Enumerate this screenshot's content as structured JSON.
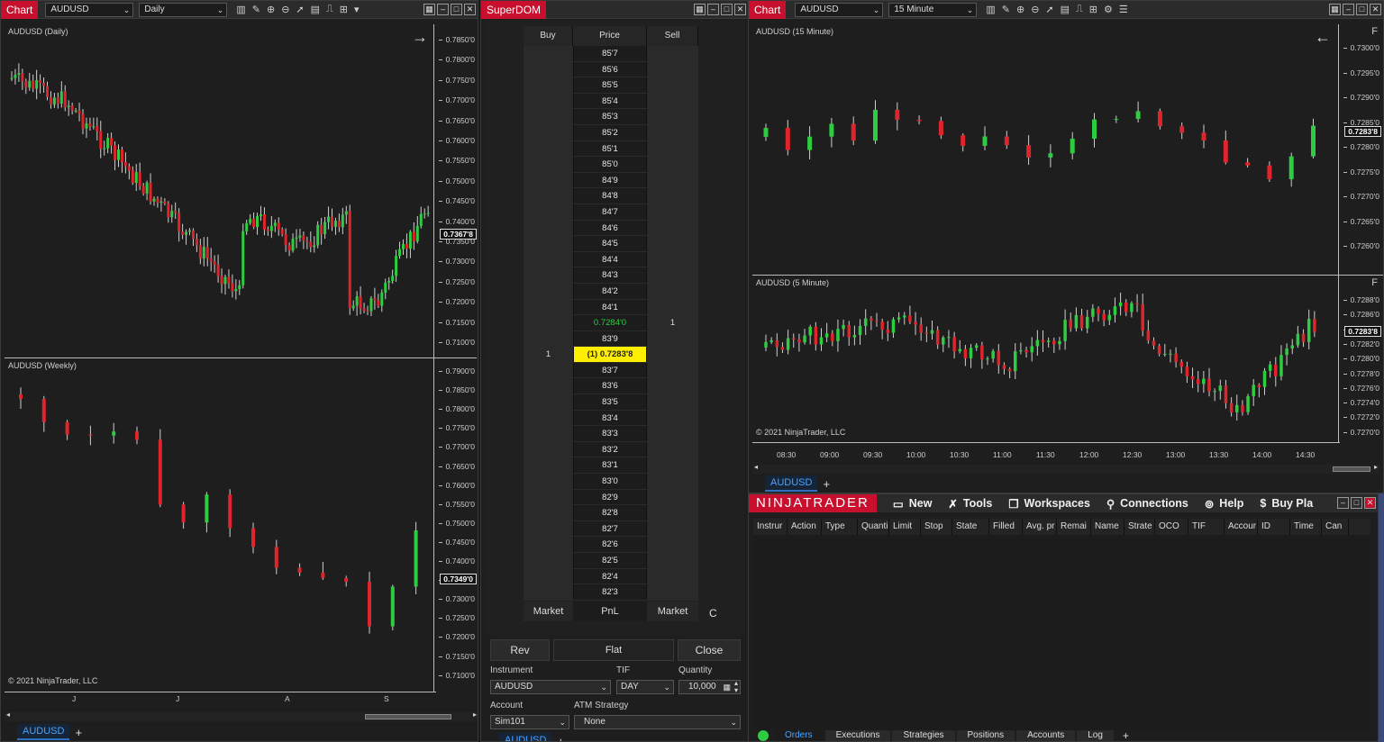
{
  "chart_left": {
    "title_label": "Chart",
    "instrument": "AUDUSD",
    "interval": "Daily",
    "panel_daily": {
      "title": "AUDUSD (Daily)",
      "y_labels": [
        "0.7850'0",
        "0.7800'0",
        "0.7750'0",
        "0.7700'0",
        "0.7650'0",
        "0.7600'0",
        "0.7550'0",
        "0.7500'0",
        "0.7450'0",
        "0.7400'0",
        "0.7350'0",
        "0.7300'0",
        "0.7250'0",
        "0.7200'0",
        "0.7150'0",
        "0.7100'0"
      ],
      "last_price": "0.7367'8"
    },
    "panel_weekly": {
      "title": "AUDUSD (Weekly)",
      "y_labels": [
        "0.7900'0",
        "0.7850'0",
        "0.7800'0",
        "0.7750'0",
        "0.7700'0",
        "0.7650'0",
        "0.7600'0",
        "0.7550'0",
        "0.7500'0",
        "0.7450'0",
        "0.7400'0",
        "0.7350'0",
        "0.7300'0",
        "0.7250'0",
        "0.7200'0",
        "0.7150'0",
        "0.7100'0"
      ],
      "last_price": "0.7349'0",
      "copyright": "© 2021 NinjaTrader, LLC",
      "x_labels": [
        "J",
        "J",
        "A",
        "S"
      ]
    },
    "tab": "AUDUSD"
  },
  "superdom": {
    "title": "SuperDOM",
    "headers": {
      "buy": "Buy",
      "price": "Price",
      "sell": "Sell"
    },
    "rows": [
      {
        "buy": "",
        "price": "85'7",
        "sell": ""
      },
      {
        "buy": "",
        "price": "85'6",
        "sell": ""
      },
      {
        "buy": "",
        "price": "85'5",
        "sell": ""
      },
      {
        "buy": "",
        "price": "85'4",
        "sell": ""
      },
      {
        "buy": "",
        "price": "85'3",
        "sell": ""
      },
      {
        "buy": "",
        "price": "85'2",
        "sell": ""
      },
      {
        "buy": "",
        "price": "85'1",
        "sell": ""
      },
      {
        "buy": "",
        "price": "85'0",
        "sell": ""
      },
      {
        "buy": "",
        "price": "84'9",
        "sell": ""
      },
      {
        "buy": "",
        "price": "84'8",
        "sell": ""
      },
      {
        "buy": "",
        "price": "84'7",
        "sell": ""
      },
      {
        "buy": "",
        "price": "84'6",
        "sell": ""
      },
      {
        "buy": "",
        "price": "84'5",
        "sell": ""
      },
      {
        "buy": "",
        "price": "84'4",
        "sell": ""
      },
      {
        "buy": "",
        "price": "84'3",
        "sell": ""
      },
      {
        "buy": "",
        "price": "84'2",
        "sell": ""
      },
      {
        "buy": "",
        "price": "84'1",
        "sell": ""
      },
      {
        "buy": "",
        "price": "0.7284'0",
        "sell": "1",
        "style": "green"
      },
      {
        "buy": "",
        "price": "83'9",
        "sell": ""
      },
      {
        "buy": "1",
        "price": "(1) 0.7283'8",
        "sell": "",
        "style": "highlight"
      },
      {
        "buy": "",
        "price": "83'7",
        "sell": ""
      },
      {
        "buy": "",
        "price": "83'6",
        "sell": ""
      },
      {
        "buy": "",
        "price": "83'5",
        "sell": ""
      },
      {
        "buy": "",
        "price": "83'4",
        "sell": ""
      },
      {
        "buy": "",
        "price": "83'3",
        "sell": ""
      },
      {
        "buy": "",
        "price": "83'2",
        "sell": ""
      },
      {
        "buy": "",
        "price": "83'1",
        "sell": ""
      },
      {
        "buy": "",
        "price": "83'0",
        "sell": ""
      },
      {
        "buy": "",
        "price": "82'9",
        "sell": ""
      },
      {
        "buy": "",
        "price": "82'8",
        "sell": ""
      },
      {
        "buy": "",
        "price": "82'7",
        "sell": ""
      },
      {
        "buy": "",
        "price": "82'6",
        "sell": ""
      },
      {
        "buy": "",
        "price": "82'5",
        "sell": ""
      },
      {
        "buy": "",
        "price": "82'4",
        "sell": ""
      },
      {
        "buy": "",
        "price": "82'3",
        "sell": ""
      }
    ],
    "footer": {
      "market_buy": "Market",
      "pnl": "PnL",
      "market_sell": "Market",
      "c": "C"
    },
    "buttons": {
      "rev": "Rev",
      "flat": "Flat",
      "close": "Close"
    },
    "labels": {
      "instrument": "Instrument",
      "tif": "TIF",
      "quantity": "Quantity",
      "account": "Account",
      "atm": "ATM Strategy"
    },
    "values": {
      "instrument": "AUDUSD",
      "tif": "DAY",
      "quantity": "10,000",
      "account": "Sim101",
      "atm": "None"
    },
    "tab": "AUDUSD"
  },
  "chart_right": {
    "title_label": "Chart",
    "instrument": "AUDUSD",
    "interval": "15 Minute",
    "panel_15": {
      "title": "AUDUSD (15 Minute)",
      "y_labels": [
        "0.7300'0",
        "0.7295'0",
        "0.7290'0",
        "0.7285'0",
        "0.7280'0",
        "0.7275'0",
        "0.7270'0",
        "0.7265'0",
        "0.7260'0"
      ],
      "last_price": "0.7283'8",
      "f_label": "F"
    },
    "panel_5": {
      "title": "AUDUSD (5 Minute)",
      "y_labels": [
        "0.7288'0",
        "0.7286'0",
        "0.7284'0",
        "0.7282'0",
        "0.7280'0",
        "0.7278'0",
        "0.7276'0",
        "0.7274'0",
        "0.7272'0",
        "0.7270'0"
      ],
      "last_price": "0.7283'8",
      "f_label": "F",
      "copyright": "© 2021 NinjaTrader, LLC",
      "x_labels": [
        "08:30",
        "09:00",
        "09:30",
        "10:00",
        "10:30",
        "11:00",
        "11:30",
        "12:00",
        "12:30",
        "13:00",
        "13:30",
        "14:00",
        "14:30"
      ]
    },
    "tab": "AUDUSD"
  },
  "control_center": {
    "logo": "NINJATRADER",
    "menu": [
      "New",
      "Tools",
      "Workspaces",
      "Connections",
      "Help",
      "Buy Pla"
    ],
    "columns": [
      "Instrur",
      "Action",
      "Type",
      "Quanti",
      "Limit",
      "Stop",
      "State",
      "Filled",
      "Avg. pr",
      "Remai",
      "Name",
      "Strate",
      "OCO",
      "TIF",
      "Accour",
      "ID",
      "Time",
      "Can"
    ],
    "tabs": [
      "Orders",
      "Executions",
      "Strategies",
      "Positions",
      "Accounts",
      "Log"
    ]
  }
}
